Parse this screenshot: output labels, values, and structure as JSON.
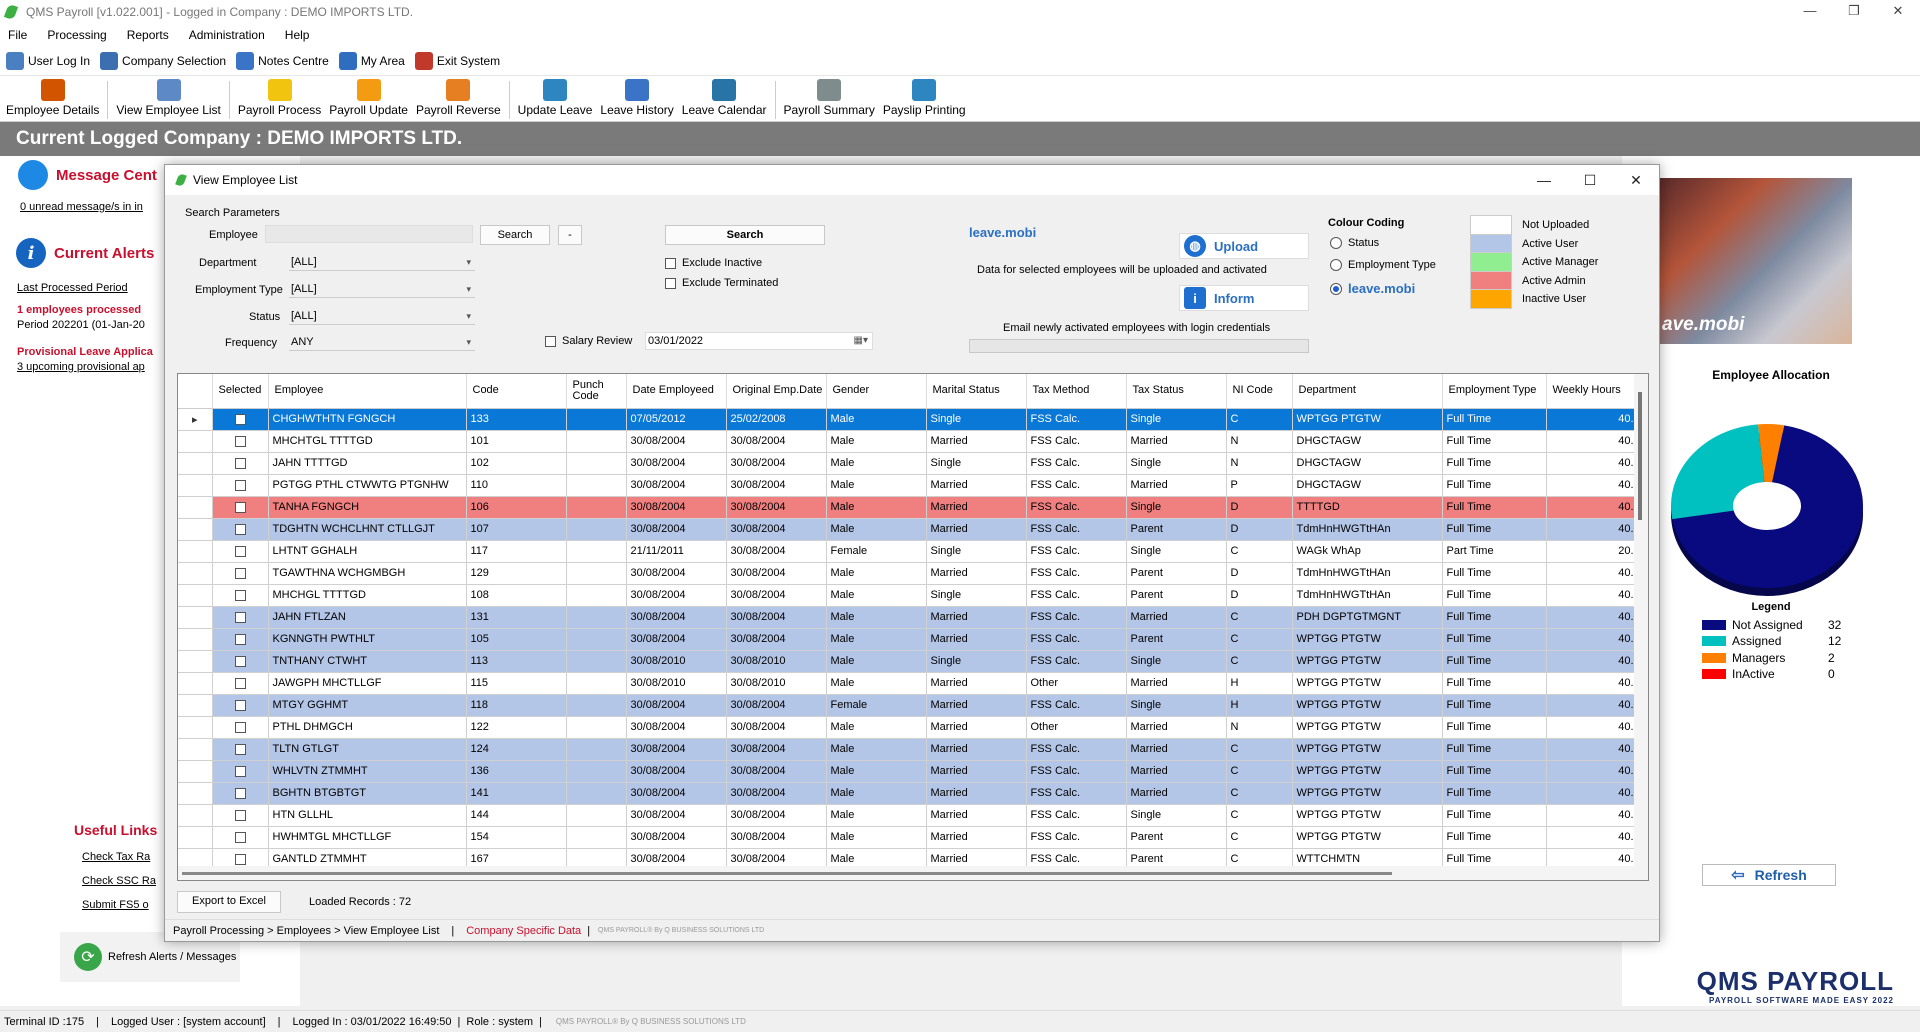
{
  "app": {
    "title": "QMS Payroll   [v1.022.001]   -   Logged in Company : DEMO IMPORTS LTD.",
    "window_controls": [
      "—",
      "❐",
      "✕"
    ]
  },
  "menu": [
    "File",
    "Processing",
    "Reports",
    "Administration",
    "Help"
  ],
  "toolbar1": [
    {
      "label": "User Log In",
      "icon": "computer-icon",
      "color": "#4a7fc1"
    },
    {
      "label": "Company Selection",
      "icon": "building-icon",
      "color": "#3c6fb0"
    },
    {
      "label": "Notes Centre",
      "icon": "mail-icon",
      "color": "#3b73c7"
    },
    {
      "label": "My Area",
      "icon": "user-icon",
      "color": "#2f6dbf"
    },
    {
      "label": "Exit System",
      "icon": "exit-icon",
      "color": "#c0392b"
    }
  ],
  "toolbar2": [
    {
      "label": "Employee Details",
      "icon": "employee-details-icon",
      "color": "#d35400",
      "sep_after": true
    },
    {
      "label": "View Employee List",
      "icon": "employee-list-icon",
      "color": "#5d8ac7",
      "sep_after": true
    },
    {
      "label": "Payroll Process",
      "icon": "coin-icon",
      "color": "#f1c40f",
      "sep_after": false
    },
    {
      "label": "Payroll Update",
      "icon": "lock-icon",
      "color": "#f39c12",
      "sep_after": false
    },
    {
      "label": "Payroll Reverse",
      "icon": "unlock-icon",
      "color": "#e67e22",
      "sep_after": true
    },
    {
      "label": "Update Leave",
      "icon": "update-leave-icon",
      "color": "#2e86c1",
      "sep_after": false
    },
    {
      "label": "Leave History",
      "icon": "leave-history-icon",
      "color": "#3b73c7",
      "sep_after": false
    },
    {
      "label": "Leave Calendar",
      "icon": "calendar-icon",
      "color": "#2874a6",
      "sep_after": true
    },
    {
      "label": "Payroll Summary",
      "icon": "printer-icon",
      "color": "#7f8c8d",
      "sep_after": false
    },
    {
      "label": "Payslip Printing",
      "icon": "envelope-icon",
      "color": "#2e86c1",
      "sep_after": false
    }
  ],
  "banner": "Current Logged Company :  DEMO IMPORTS LTD.",
  "left_panel": {
    "message_title": "Message Cent",
    "message_link": "0 unread message/s in in",
    "alerts_title": "Current Alerts",
    "last_period_link": "Last Processed Period",
    "employees_processed": "1 employees processed",
    "period": "Period 202201 (01-Jan-20",
    "provisional_leave": "Provisional Leave Applica",
    "upcoming_link": "3 upcoming provisional ap",
    "useful_links_title": "Useful Links",
    "links": [
      "Check Tax Ra",
      "Check SSC Ra",
      "Submit FS5 o"
    ],
    "refresh": "Refresh Alerts / Messages"
  },
  "dialog": {
    "title": "View Employee List",
    "controls": [
      "—",
      "☐",
      "✕"
    ],
    "search_params": "Search Parameters",
    "employee_label": "Employee",
    "employee_value": "",
    "search_small": "Search",
    "minus": "-",
    "search_big": "Search",
    "department_label": "Department",
    "department_value": "[ALL]",
    "emp_type_label": "Employment Type",
    "emp_type_value": "[ALL]",
    "status_label": "Status",
    "status_value": "[ALL]",
    "frequency_label": "Frequency",
    "frequency_value": "ANY",
    "exclude_inactive": "Exclude Inactive",
    "exclude_terminated": "Exclude Terminated",
    "salary_review": "Salary Review",
    "salary_review_date": "03/01/2022",
    "leave_mobi": {
      "brand": "leave.mobi",
      "upload": "Upload",
      "upload_text": "Data for selected employees will be uploaded and activated",
      "inform": "Inform",
      "inform_text": "Email newly activated employees with login credentials"
    },
    "colour_coding": {
      "title": "Colour Coding",
      "options": [
        {
          "label": "Status",
          "selected": false
        },
        {
          "label": "Employment Type",
          "selected": false
        },
        {
          "label": "leave.mobi",
          "selected": true
        }
      ],
      "legend": [
        {
          "label": "Not Uploaded",
          "color": "#ffffff"
        },
        {
          "label": "Active User",
          "color": "#b4c6e7"
        },
        {
          "label": "Active Manager",
          "color": "#90ee90"
        },
        {
          "label": "Active Admin",
          "color": "#f08080"
        },
        {
          "label": "Inactive User",
          "color": "#ffa500"
        }
      ]
    },
    "columns": [
      "Selected",
      "Employee",
      "Code",
      "Punch Code",
      "Date Employeed",
      "Original Emp.Date",
      "Gender",
      "Marital Status",
      "Tax Method",
      "Tax Status",
      "NI Code",
      "Department",
      "Employment Type",
      "Weekly Hours"
    ],
    "rows": [
      {
        "style": "cur",
        "cells": [
          "CHGHWTHTN FGNGCH",
          "133",
          "",
          "07/05/2012",
          "25/02/2008",
          "Male",
          "Single",
          "FSS Calc.",
          "Single",
          "C",
          "WPTGG PTGTW",
          "Full Time",
          "40."
        ]
      },
      {
        "style": "white",
        "cells": [
          "MHCHTGL TTTTGD",
          "101",
          "",
          "30/08/2004",
          "30/08/2004",
          "Male",
          "Married",
          "FSS Calc.",
          "Married",
          "N",
          "DHGCTAGW",
          "Full Time",
          "40."
        ]
      },
      {
        "style": "white",
        "cells": [
          "JAHN TTTTGD",
          "102",
          "",
          "30/08/2004",
          "30/08/2004",
          "Male",
          "Single",
          "FSS Calc.",
          "Single",
          "N",
          "DHGCTAGW",
          "Full Time",
          "40."
        ]
      },
      {
        "style": "white",
        "cells": [
          "PGTGG PTHL CTWWTG PTGNHW",
          "110",
          "",
          "30/08/2004",
          "30/08/2004",
          "Male",
          "Married",
          "FSS Calc.",
          "Married",
          "P",
          "DHGCTAGW",
          "Full Time",
          "40."
        ]
      },
      {
        "style": "red",
        "cells": [
          "TANHA FGNGCH",
          "106",
          "",
          "30/08/2004",
          "30/08/2004",
          "Male",
          "Married",
          "FSS Calc.",
          "Single",
          "D",
          "TTTTGD",
          "Full Time",
          "40."
        ]
      },
      {
        "style": "blue",
        "cells": [
          "TDGHTN WCHCLHNT CTLLGJT",
          "107",
          "",
          "30/08/2004",
          "30/08/2004",
          "Male",
          "Married",
          "FSS Calc.",
          "Parent",
          "D",
          "TdmHnHWGTtHAn",
          "Full Time",
          "40."
        ]
      },
      {
        "style": "white",
        "cells": [
          "LHTNT GGHALH",
          "117",
          "",
          "21/11/2011",
          "30/08/2004",
          "Female",
          "Single",
          "FSS Calc.",
          "Single",
          "C",
          "WAGk WhAp",
          "Part Time",
          "20."
        ]
      },
      {
        "style": "white",
        "cells": [
          "TGAWTHNA WCHGMBGH",
          "129",
          "",
          "30/08/2004",
          "30/08/2004",
          "Male",
          "Married",
          "FSS Calc.",
          "Parent",
          "D",
          "TdmHnHWGTtHAn",
          "Full Time",
          "40."
        ]
      },
      {
        "style": "white",
        "cells": [
          "MHCHGL TTTTGD",
          "108",
          "",
          "30/08/2004",
          "30/08/2004",
          "Male",
          "Single",
          "FSS Calc.",
          "Parent",
          "D",
          "TdmHnHWGTtHAn",
          "Full Time",
          "40."
        ]
      },
      {
        "style": "blue",
        "cells": [
          "JAHN FTLZAN",
          "131",
          "",
          "30/08/2004",
          "30/08/2004",
          "Male",
          "Married",
          "FSS Calc.",
          "Married",
          "C",
          "PDH DGPTGTMGNT",
          "Full Time",
          "40."
        ]
      },
      {
        "style": "blue",
        "cells": [
          "KGNNGTH PWTHLT",
          "105",
          "",
          "30/08/2004",
          "30/08/2004",
          "Male",
          "Married",
          "FSS Calc.",
          "Parent",
          "C",
          "WPTGG PTGTW",
          "Full Time",
          "40."
        ]
      },
      {
        "style": "blue",
        "cells": [
          "TNTHANY CTWHT",
          "113",
          "",
          "30/08/2010",
          "30/08/2010",
          "Male",
          "Single",
          "FSS Calc.",
          "Single",
          "C",
          "WPTGG PTGTW",
          "Full Time",
          "40."
        ]
      },
      {
        "style": "white",
        "cells": [
          "JAWGPH MHCTLLGF",
          "115",
          "",
          "30/08/2010",
          "30/08/2010",
          "Male",
          "Married",
          "Other",
          "Married",
          "H",
          "WPTGG PTGTW",
          "Full Time",
          "40."
        ]
      },
      {
        "style": "blue",
        "cells": [
          "MTGY GGHMT",
          "118",
          "",
          "30/08/2004",
          "30/08/2004",
          "Female",
          "Married",
          "FSS Calc.",
          "Single",
          "H",
          "WPTGG PTGTW",
          "Full Time",
          "40."
        ]
      },
      {
        "style": "white",
        "cells": [
          "PTHL DHMGCH",
          "122",
          "",
          "30/08/2004",
          "30/08/2004",
          "Male",
          "Married",
          "Other",
          "Married",
          "N",
          "WPTGG PTGTW",
          "Full Time",
          "40."
        ]
      },
      {
        "style": "blue",
        "cells": [
          "TLTN GTLGT",
          "124",
          "",
          "30/08/2004",
          "30/08/2004",
          "Male",
          "Married",
          "FSS Calc.",
          "Married",
          "C",
          "WPTGG PTGTW",
          "Full Time",
          "40."
        ]
      },
      {
        "style": "blue",
        "cells": [
          "WHLVTN ZTMMHT",
          "136",
          "",
          "30/08/2004",
          "30/08/2004",
          "Male",
          "Married",
          "FSS Calc.",
          "Married",
          "C",
          "WPTGG PTGTW",
          "Full Time",
          "40."
        ]
      },
      {
        "style": "blue",
        "cells": [
          "BGHTN BTGBTGT",
          "141",
          "",
          "30/08/2004",
          "30/08/2004",
          "Male",
          "Married",
          "FSS Calc.",
          "Married",
          "C",
          "WPTGG PTGTW",
          "Full Time",
          "40."
        ]
      },
      {
        "style": "white",
        "cells": [
          "HTN GLLHL",
          "144",
          "",
          "30/08/2004",
          "30/08/2004",
          "Male",
          "Married",
          "FSS Calc.",
          "Single",
          "C",
          "WPTGG PTGTW",
          "Full Time",
          "40."
        ]
      },
      {
        "style": "white",
        "cells": [
          "HWHMTGL MHCTLLGF",
          "154",
          "",
          "30/08/2004",
          "30/08/2004",
          "Male",
          "Married",
          "FSS Calc.",
          "Parent",
          "C",
          "WPTGG PTGTW",
          "Full Time",
          "40."
        ]
      },
      {
        "style": "white",
        "cells": [
          "GANTLD ZTMMHT",
          "167",
          "",
          "30/08/2004",
          "30/08/2004",
          "Male",
          "Married",
          "FSS Calc.",
          "Parent",
          "C",
          "WTTCHMTN",
          "Full Time",
          "40."
        ]
      }
    ],
    "export": "Export to Excel",
    "loaded_records": "Loaded Records : 72",
    "footer_path": "Payroll Processing > Employees > View Employee List",
    "footer_sep": "|",
    "footer_red": "Company Specific Data",
    "footer_small": "QMS PAYROLL® By Q BUSINESS SOLUTIONS LTD"
  },
  "right_panel": {
    "photo_brand": "ave.mobi",
    "allocation_title": "Employee Allocation",
    "legend_title": "Legend",
    "legend": [
      {
        "label": "Not Assigned",
        "value": 32,
        "color": "#0a0a80"
      },
      {
        "label": "Assigned",
        "value": 12,
        "color": "#00c0c0"
      },
      {
        "label": "Managers",
        "value": 2,
        "color": "#ff8000"
      },
      {
        "label": "InActive",
        "value": 0,
        "color": "#ff0000"
      }
    ],
    "refresh": "Refresh",
    "logo": "QMS PAYROLL",
    "logo_sub": "PAYROLL SOFTWARE MADE EASY 2022"
  },
  "status_bar": {
    "terminal": "Terminal ID :175",
    "user": "Logged User : [system account]",
    "logged_in": "Logged In : 03/01/2022 16:49:50",
    "role": "Role : system",
    "small": "QMS PAYROLL® By Q BUSINESS SOLUTIONS LTD"
  }
}
